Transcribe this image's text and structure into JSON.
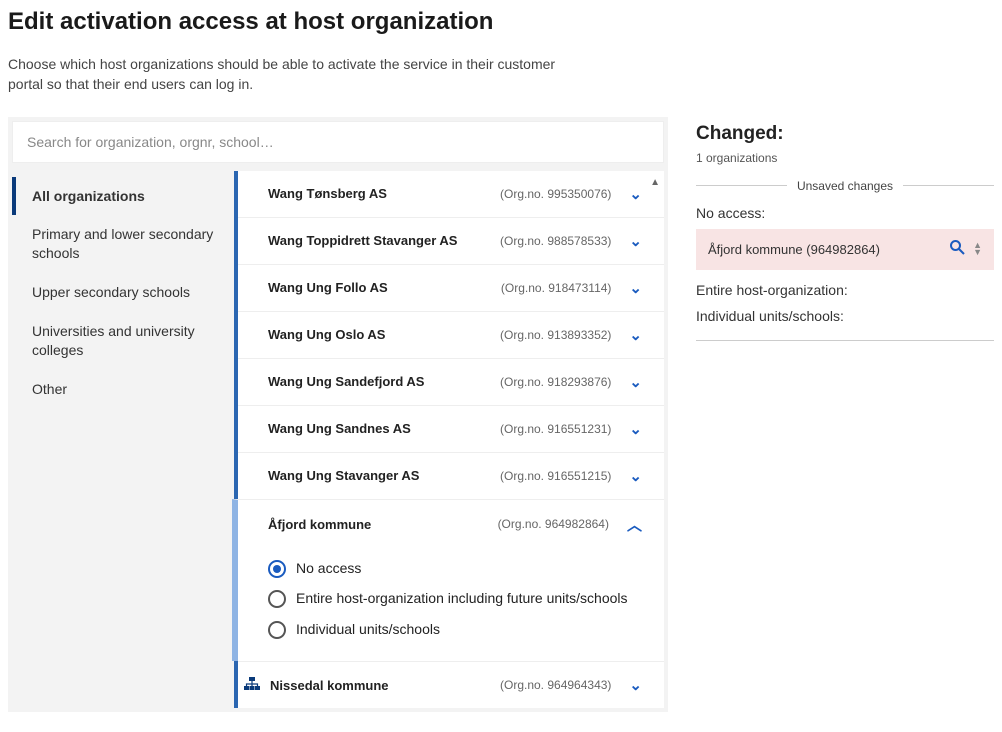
{
  "title": "Edit activation access at host organization",
  "intro": "Choose which host organizations should be able to activate the service in their customer portal so that their end users can log in.",
  "search_placeholder": "Search for organization, orgnr, school…",
  "filters": [
    "All organizations",
    "Primary and lower secondary schools",
    "Upper secondary schools",
    "Universities and university colleges",
    "Other"
  ],
  "organizations": [
    {
      "name": "Wang Tønsberg AS",
      "orgnr": "(Org.no. 995350076)"
    },
    {
      "name": "Wang Toppidrett Stavanger AS",
      "orgnr": "(Org.no. 988578533)"
    },
    {
      "name": "Wang Ung Follo AS",
      "orgnr": "(Org.no. 918473114)"
    },
    {
      "name": "Wang Ung Oslo AS",
      "orgnr": "(Org.no. 913893352)"
    },
    {
      "name": "Wang Ung Sandefjord AS",
      "orgnr": "(Org.no. 918293876)"
    },
    {
      "name": "Wang Ung Sandnes AS",
      "orgnr": "(Org.no. 916551231)"
    },
    {
      "name": "Wang Ung Stavanger AS",
      "orgnr": "(Org.no. 916551215)"
    }
  ],
  "expanded": {
    "name": "Åfjord kommune",
    "orgnr": "(Org.no. 964982864)",
    "options": [
      "No access",
      "Entire host-organization including future units/schools",
      "Individual units/schools"
    ]
  },
  "bottom_row": {
    "name": "Nissedal kommune",
    "orgnr": "(Org.no. 964964343)"
  },
  "changed": {
    "title": "Changed:",
    "count": "1 organizations",
    "unsaved_label": "Unsaved changes",
    "no_access_label": "No access:",
    "chip": "Åfjord kommune (964982864)",
    "entire_label": "Entire host-organization:",
    "individual_label": "Individual units/schools:"
  }
}
